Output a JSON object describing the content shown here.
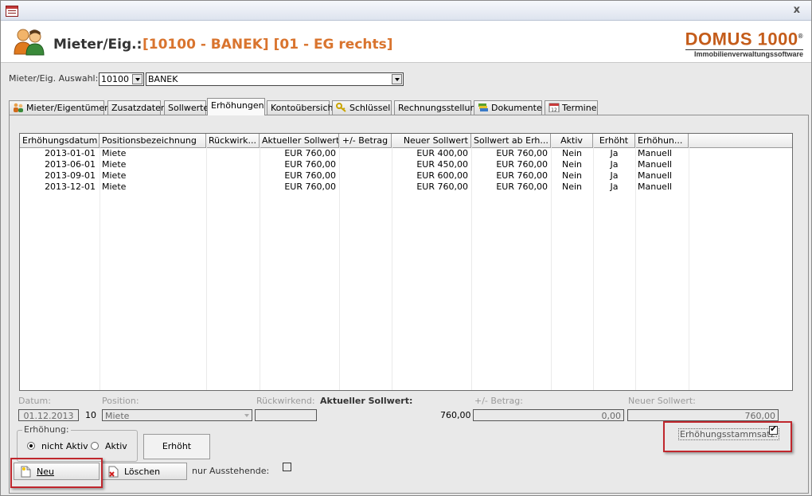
{
  "header": {
    "label": "Mieter/Eig.:",
    "value": "[10100 - BANEK] [01 - EG rechts]",
    "logo_main": "DOMUS 1000",
    "logo_sup": "®",
    "logo_sub": "Immobilienverwaltungssoftware"
  },
  "window": {
    "close": "x"
  },
  "selection": {
    "label": "Mieter/Eig. Auswahl:",
    "id_value": "10100",
    "name_value": "BANEK"
  },
  "tabs": [
    {
      "label": "Mieter/Eigentümer",
      "icon": "users-icon"
    },
    {
      "label": "Zusatzdaten"
    },
    {
      "label": "Sollwerte"
    },
    {
      "label": "Erhöhungen",
      "active": true
    },
    {
      "label": "Kontoübersicht"
    },
    {
      "label": "Schlüssel",
      "icon": "keys-icon"
    },
    {
      "label": "Rechnungsstellung"
    },
    {
      "label": "Dokumente",
      "icon": "documents-icon"
    },
    {
      "label": "Termine",
      "icon": "calendar-icon"
    }
  ],
  "grid": {
    "columns": [
      "Erhöhungsdatum",
      "Positionsbezeichnung",
      "Rückwirk...",
      "Aktueller Sollwert",
      "+/- Betrag",
      "Neuer Sollwert",
      "Sollwert ab Erh...",
      "Aktiv",
      "Erhöht",
      "Erhöhun..."
    ],
    "rows": [
      [
        "2013-01-01",
        "Miete",
        "",
        "EUR 760,00",
        "",
        "EUR 400,00",
        "EUR 760,00",
        "Nein",
        "Ja",
        "Manuell"
      ],
      [
        "2013-06-01",
        "Miete",
        "",
        "EUR 760,00",
        "",
        "EUR 450,00",
        "EUR 760,00",
        "Nein",
        "Ja",
        "Manuell"
      ],
      [
        "2013-09-01",
        "Miete",
        "",
        "EUR 760,00",
        "",
        "EUR 600,00",
        "EUR 760,00",
        "Nein",
        "Ja",
        "Manuell"
      ],
      [
        "2013-12-01",
        "Miete",
        "",
        "EUR 760,00",
        "",
        "EUR 760,00",
        "EUR 760,00",
        "Nein",
        "Ja",
        "Manuell"
      ]
    ]
  },
  "form": {
    "datum_label": "Datum:",
    "datum_value": "01.12.2013",
    "pos_num": "10",
    "position_label": "Position:",
    "position_value": "Miete",
    "rueckwirkend_label": "Rückwirkend:",
    "rueckwirkend_value": "",
    "aktueller_label": "Aktueller Sollwert:",
    "aktueller_value": "760,00",
    "betrag_label": "+/- Betrag:",
    "betrag_value": "0,00",
    "neuer_label": "Neuer Sollwert:",
    "neuer_value": "760,00",
    "stammsatz_label": "Erhöhungsstammsatz:",
    "stammsatz_checked": true,
    "erhoehung_group": "Erhöhung:",
    "radio_nicht_aktiv": "nicht Aktiv",
    "radio_aktiv": "Aktiv",
    "selected_radio": "nicht Aktiv",
    "erhoeht_label": "Erhöht",
    "nur_ausstehende_label": "nur Ausstehende:",
    "nur_ausstehende_checked": false
  },
  "buttons": {
    "neu": "Neu",
    "loeschen": "Löschen"
  },
  "colors": {
    "accent_orange": "#d9742e",
    "logo_orange": "#c45c1a",
    "highlight_red": "#c0272d"
  }
}
